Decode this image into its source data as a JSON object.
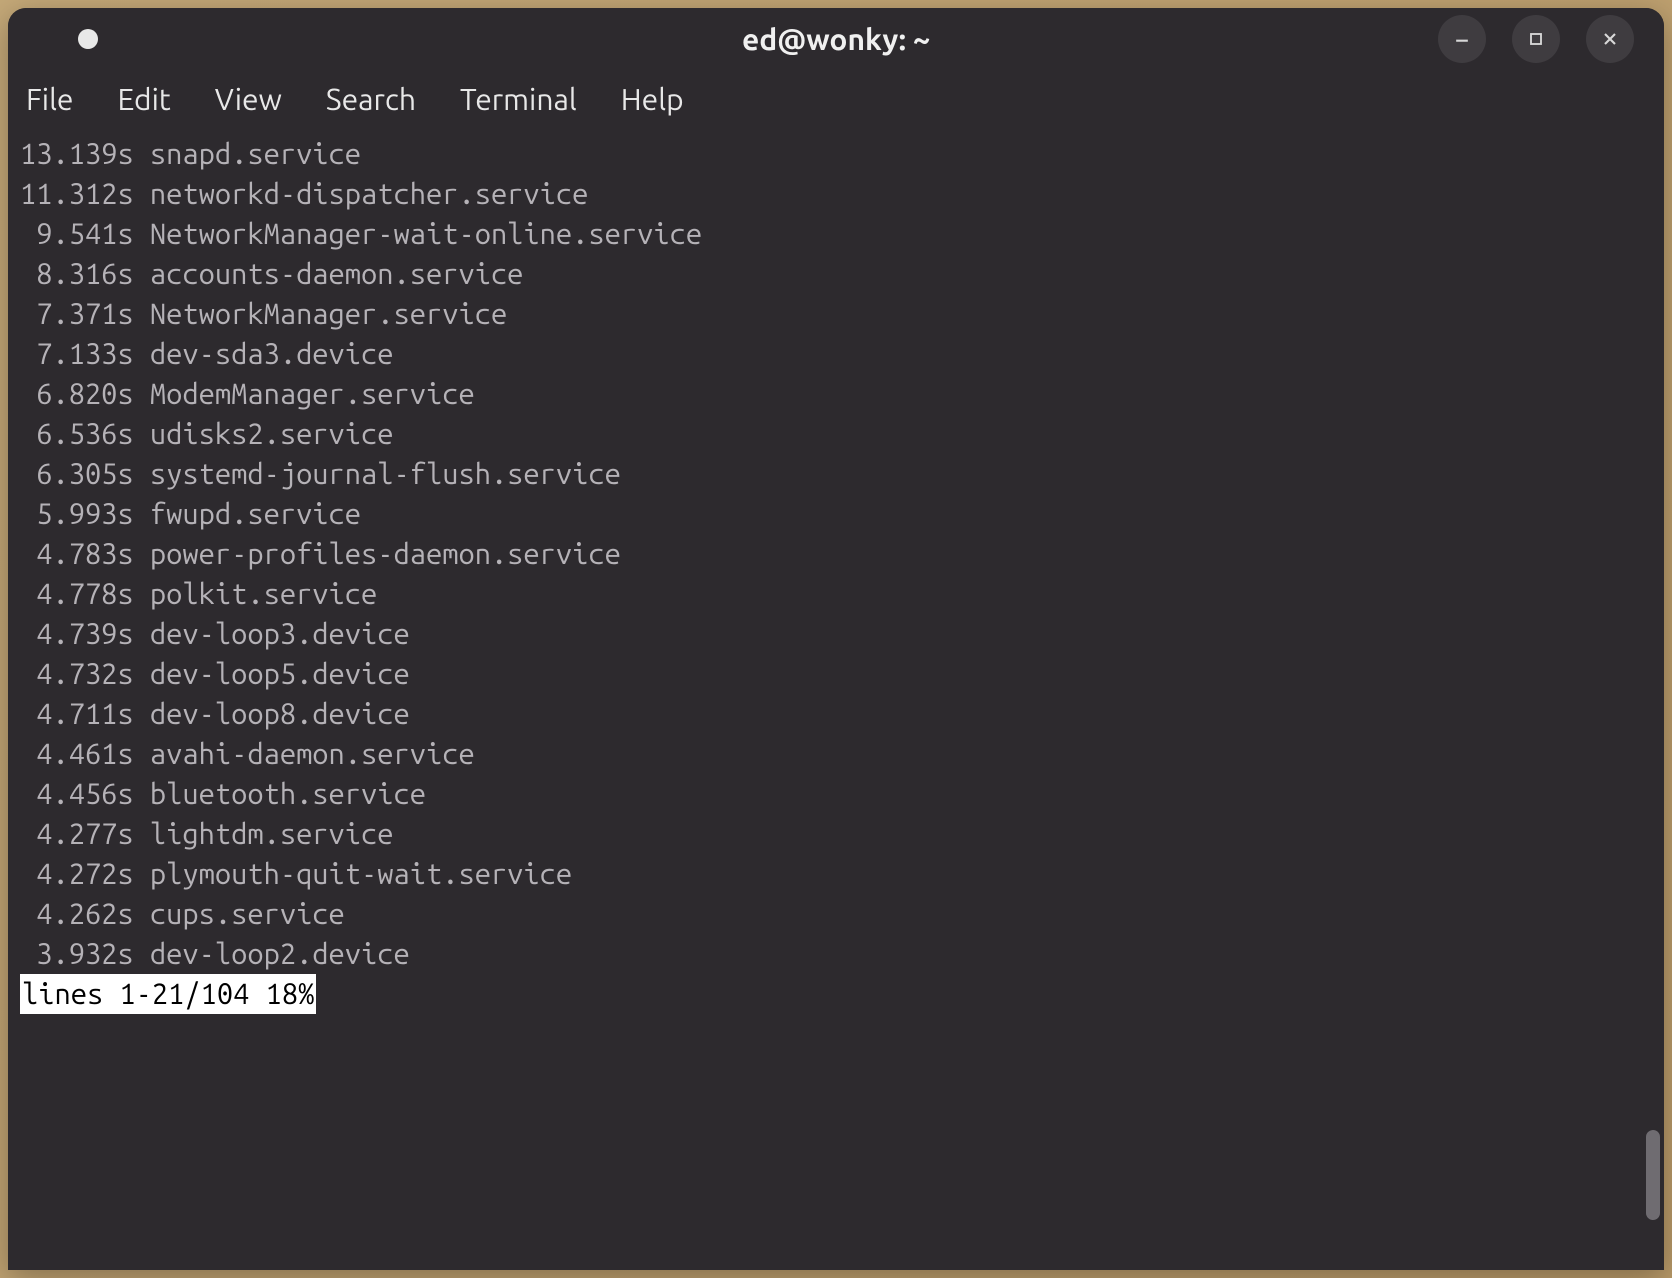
{
  "window": {
    "title": "ed@wonky: ~"
  },
  "menubar": {
    "items": [
      "File",
      "Edit",
      "View",
      "Search",
      "Terminal",
      "Help"
    ]
  },
  "terminal": {
    "lines": [
      {
        "time": "13.139s",
        "service": "snapd.service"
      },
      {
        "time": "11.312s",
        "service": "networkd-dispatcher.service"
      },
      {
        "time": "9.541s",
        "service": "NetworkManager-wait-online.service"
      },
      {
        "time": "8.316s",
        "service": "accounts-daemon.service"
      },
      {
        "time": "7.371s",
        "service": "NetworkManager.service"
      },
      {
        "time": "7.133s",
        "service": "dev-sda3.device"
      },
      {
        "time": "6.820s",
        "service": "ModemManager.service"
      },
      {
        "time": "6.536s",
        "service": "udisks2.service"
      },
      {
        "time": "6.305s",
        "service": "systemd-journal-flush.service"
      },
      {
        "time": "5.993s",
        "service": "fwupd.service"
      },
      {
        "time": "4.783s",
        "service": "power-profiles-daemon.service"
      },
      {
        "time": "4.778s",
        "service": "polkit.service"
      },
      {
        "time": "4.739s",
        "service": "dev-loop3.device"
      },
      {
        "time": "4.732s",
        "service": "dev-loop5.device"
      },
      {
        "time": "4.711s",
        "service": "dev-loop8.device"
      },
      {
        "time": "4.461s",
        "service": "avahi-daemon.service"
      },
      {
        "time": "4.456s",
        "service": "bluetooth.service"
      },
      {
        "time": "4.277s",
        "service": "lightdm.service"
      },
      {
        "time": "4.272s",
        "service": "plymouth-quit-wait.service"
      },
      {
        "time": "4.262s",
        "service": "cups.service"
      },
      {
        "time": "3.932s",
        "service": "dev-loop2.device"
      }
    ],
    "pager_status": "lines 1-21/104 18%"
  }
}
